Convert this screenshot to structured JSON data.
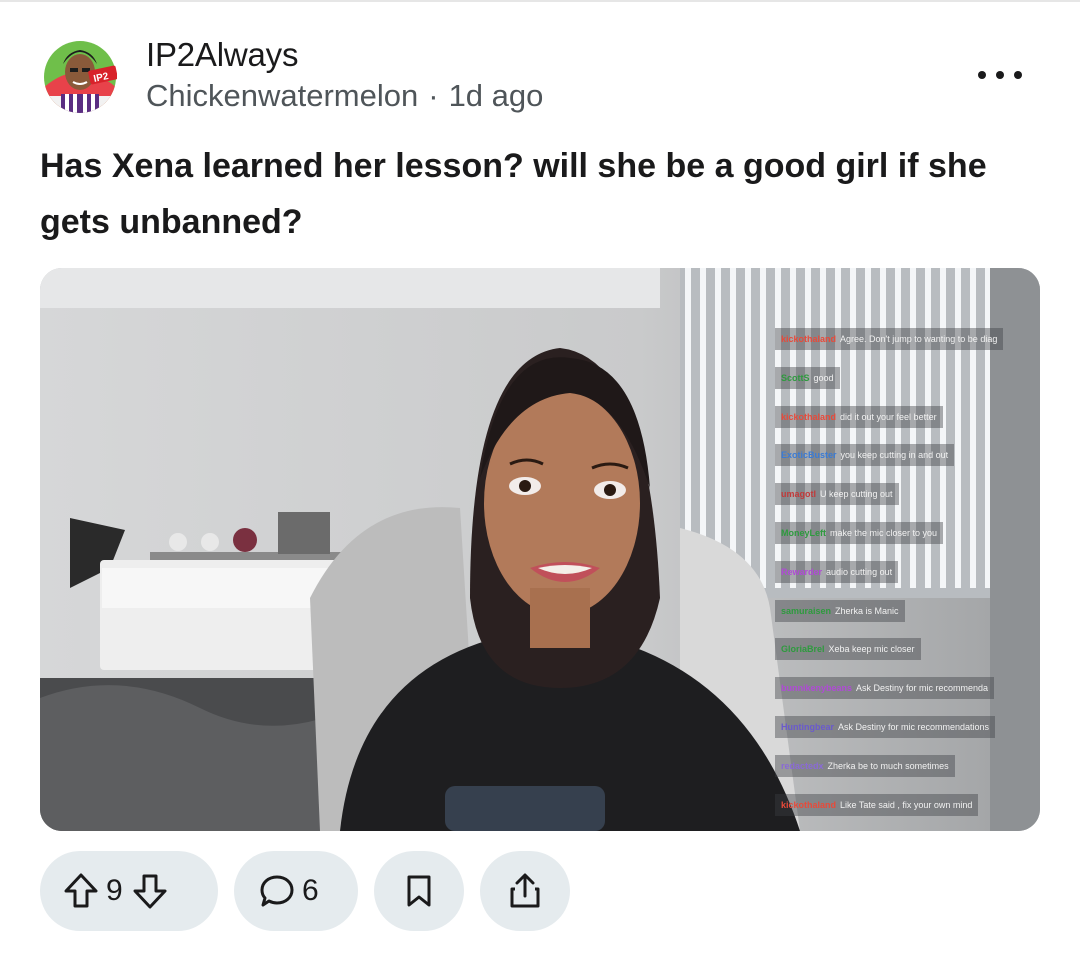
{
  "post": {
    "subreddit": "IP2Always",
    "author": "Chickenwatermelon",
    "separator": "·",
    "age": "1d ago",
    "title": "Has Xena learned her lesson? will she be a good girl if she gets unbanned?"
  },
  "avatar": {
    "badge_text": "IP2"
  },
  "media": {
    "chat": [
      {
        "user": "kickothaland",
        "text": "Agree. Don't jump to wanting to be diag",
        "color": "#e84a3a"
      },
      {
        "user": "ScottS",
        "text": "good",
        "color": "#2e9a3e"
      },
      {
        "user": "kickothaland",
        "text": "did it out your feel better",
        "color": "#e84a3a"
      },
      {
        "user": "ExoticBuster",
        "text": "you keep cutting in and out",
        "color": "#3a7bd5"
      },
      {
        "user": "umagotl",
        "text": "U keep cutting out",
        "color": "#c23a3a"
      },
      {
        "user": "MoneyLeft",
        "text": "make the mic closer to you",
        "color": "#2e9a3e"
      },
      {
        "user": "Rewarder",
        "text": "audio cutting out",
        "color": "#b04ad6"
      },
      {
        "user": "samuraisen",
        "text": "Zherka is Manic",
        "color": "#2e9a3e"
      },
      {
        "user": "GloriaBrel",
        "text": "Xeba keep mic closer",
        "color": "#2e9a3e"
      },
      {
        "user": "bunnikenybeans",
        "text": "Ask Destiny for mic recommenda",
        "color": "#b04ad6"
      },
      {
        "user": "Huntingbear",
        "text": "Ask Destiny for mic recommendations",
        "color": "#6a5acd"
      },
      {
        "user": "redactedx",
        "text": "Zherka be to much sometimes",
        "color": "#8a6ad6"
      },
      {
        "user": "kickothaland",
        "text": "Like Tate said , fix your own mind",
        "color": "#e84a3a"
      }
    ]
  },
  "actions": {
    "upvote_count": "9",
    "comment_count": "6"
  },
  "icons": {
    "more": "more-options-icon",
    "upvote": "upvote-arrow-icon",
    "downvote": "downvote-arrow-icon",
    "comment": "comment-bubble-icon",
    "save": "bookmark-icon",
    "share": "share-icon"
  }
}
